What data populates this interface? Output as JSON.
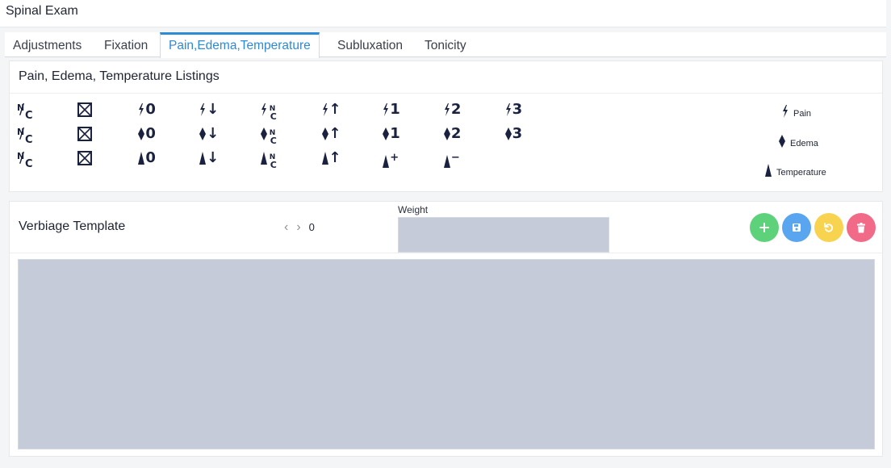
{
  "page": {
    "title": "Spinal Exam"
  },
  "tabs": [
    {
      "label": "Adjustments",
      "active": false
    },
    {
      "label": "Fixation",
      "active": false
    },
    {
      "label": "Pain,Edema,Temperature",
      "active": true
    },
    {
      "label": "Subluxation",
      "active": false
    },
    {
      "label": "Tonicity",
      "active": false
    }
  ],
  "listings": {
    "title": "Pain, Edema, Temperature Listings",
    "rows": [
      {
        "type": "pain",
        "suffixes": [
          "N/C",
          "box",
          "0",
          "↓",
          "NC",
          "↑",
          "1",
          "2",
          "3"
        ]
      },
      {
        "type": "edema",
        "suffixes": [
          "N/C",
          "box",
          "0",
          "↓",
          "NC",
          "↑",
          "1",
          "2",
          "3"
        ]
      },
      {
        "type": "temperature",
        "suffixes": [
          "N/C",
          "box",
          "0",
          "↓",
          "NC",
          "↑",
          "+",
          "−"
        ]
      }
    ],
    "legend": [
      {
        "icon": "pain-icon",
        "label": "Pain"
      },
      {
        "icon": "edema-icon",
        "label": "Edema"
      },
      {
        "icon": "temperature-icon",
        "label": "Temperature"
      }
    ]
  },
  "verbiage": {
    "title": "Verbiage Template",
    "pager_value": "0",
    "weight_label": "Weight",
    "weight_value": "",
    "text_value": "",
    "buttons": {
      "add": "add-icon",
      "save": "save-icon",
      "undo": "undo-icon",
      "delete": "delete-icon"
    }
  },
  "colors": {
    "accent": "#2d8ad6",
    "input_bg": "#c5cbd9",
    "add": "#5dd27b",
    "save": "#5aa5f0",
    "undo": "#f7d34f",
    "delete": "#f16a87",
    "symbol": "#1b2240"
  }
}
